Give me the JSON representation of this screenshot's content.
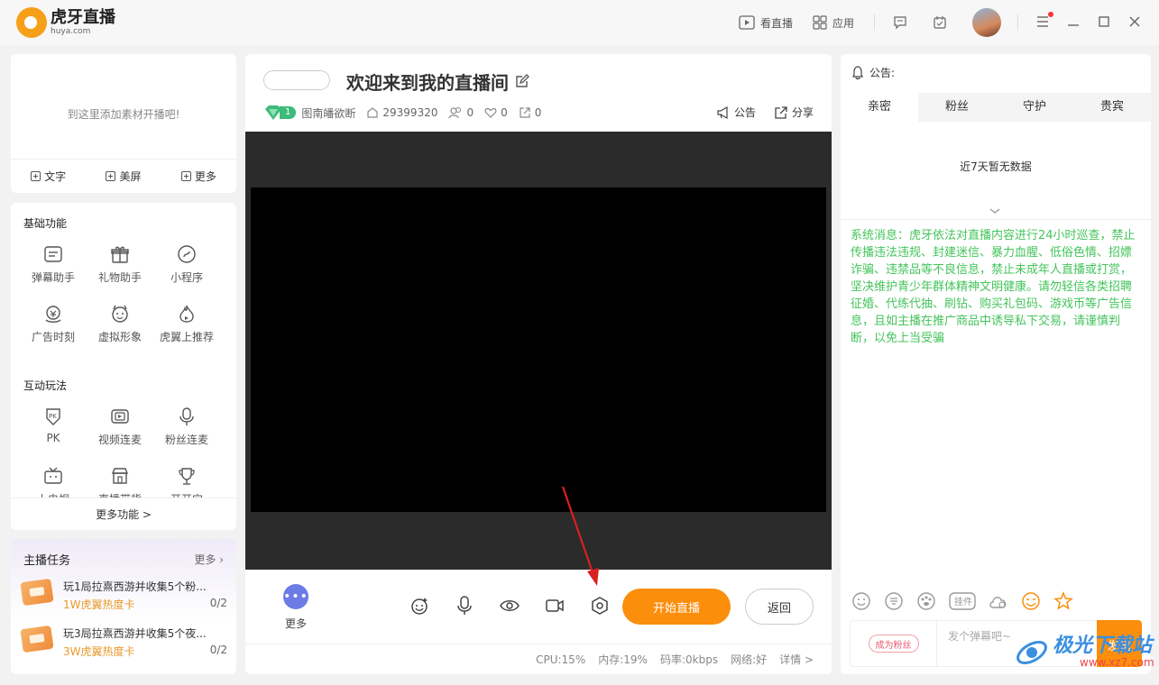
{
  "app": {
    "name": "虎牙直播",
    "domain": "huya.com"
  },
  "topbar": {
    "watch_label": "看直播",
    "apps_label": "应用"
  },
  "add_panel": {
    "hint": "到这里添加素材开播吧!",
    "buttons": [
      "文字",
      "美屏",
      "更多"
    ]
  },
  "basic": {
    "title": "基础功能",
    "items": [
      {
        "label": "弹幕助手",
        "icon": "barrage-icon"
      },
      {
        "label": "礼物助手",
        "icon": "gift-icon"
      },
      {
        "label": "小程序",
        "icon": "mini-program-icon"
      },
      {
        "label": "广告时刻",
        "icon": "ad-icon"
      },
      {
        "label": "虚拟形象",
        "icon": "avatar-face-icon"
      },
      {
        "label": "虎翼上推荐",
        "icon": "flame-icon"
      }
    ]
  },
  "interactive": {
    "title": "互动玩法",
    "items": [
      {
        "label": "PK",
        "icon": "pk-icon"
      },
      {
        "label": "视频连麦",
        "icon": "video-link-icon"
      },
      {
        "label": "粉丝连麦",
        "icon": "mic-icon"
      },
      {
        "label": "上电视",
        "icon": "tv-icon"
      },
      {
        "label": "直播带货",
        "icon": "shop-icon"
      },
      {
        "label": "开开宝",
        "icon": "trophy-icon"
      }
    ],
    "more_label": "更多功能 >"
  },
  "tasks": {
    "title": "主播任务",
    "more_label": "更多",
    "items": [
      {
        "name": "玩1局拉熹西游并收集5个粉...",
        "reward": "1W虎翼热度卡",
        "progress": "0/2"
      },
      {
        "name": "玩3局拉熹西游并收集5个夜...",
        "reward": "3W虎翼热度卡",
        "progress": "0/2"
      }
    ]
  },
  "room": {
    "title": "欢迎来到我的直播间",
    "level": "1",
    "category": "图南皤欲断",
    "room_id": "29399320",
    "fans": "0",
    "likes": "0",
    "shares": "0",
    "notice_label": "公告",
    "share_label": "分享"
  },
  "controls": {
    "more_label": "更多",
    "start_label": "开始直播",
    "back_label": "返回"
  },
  "status": {
    "cpu": "CPU:15%",
    "mem": "内存:19%",
    "bitrate": "码率:0kbps",
    "network": "网络:好",
    "detail": "详情 >"
  },
  "right": {
    "notice_label": "公告:",
    "tabs": [
      "亲密",
      "粉丝",
      "守护",
      "贵宾"
    ],
    "empty_text": "近7天暂无数据",
    "system_message": "系统消息：虎牙依法对直播内容进行24小时巡查，禁止传播违法违规、封建迷信、暴力血腥、低俗色情、招嫖诈骗、违禁品等不良信息，禁止未成年人直播或打赏，坚决维护青少年群体精神文明健康。请勿轻信各类招聘征婚、代练代抽、刷钻、购买礼包码、游戏币等广告信息，且如主播在推广商品中诱导私下交易，请谨慎判断，以免上当受骗",
    "emoji_bar": [
      "smile-icon",
      "keyboard-icon",
      "paw-icon",
      "plugin-label-icon",
      "cloud-icon",
      "happy-icon",
      "star-icon"
    ],
    "plugin_label": "挂件",
    "fan_badge": "成为粉丝",
    "input_placeholder": "发个弹幕吧~",
    "send_label": "发送"
  },
  "watermark": {
    "text": "极光下载站",
    "url": "www.xz7.com"
  },
  "colors": {
    "accent": "#fb8e0b",
    "system_msg": "#44c45b",
    "level_badge": "#3dbb7a",
    "more_btn": "#6c7be6"
  }
}
